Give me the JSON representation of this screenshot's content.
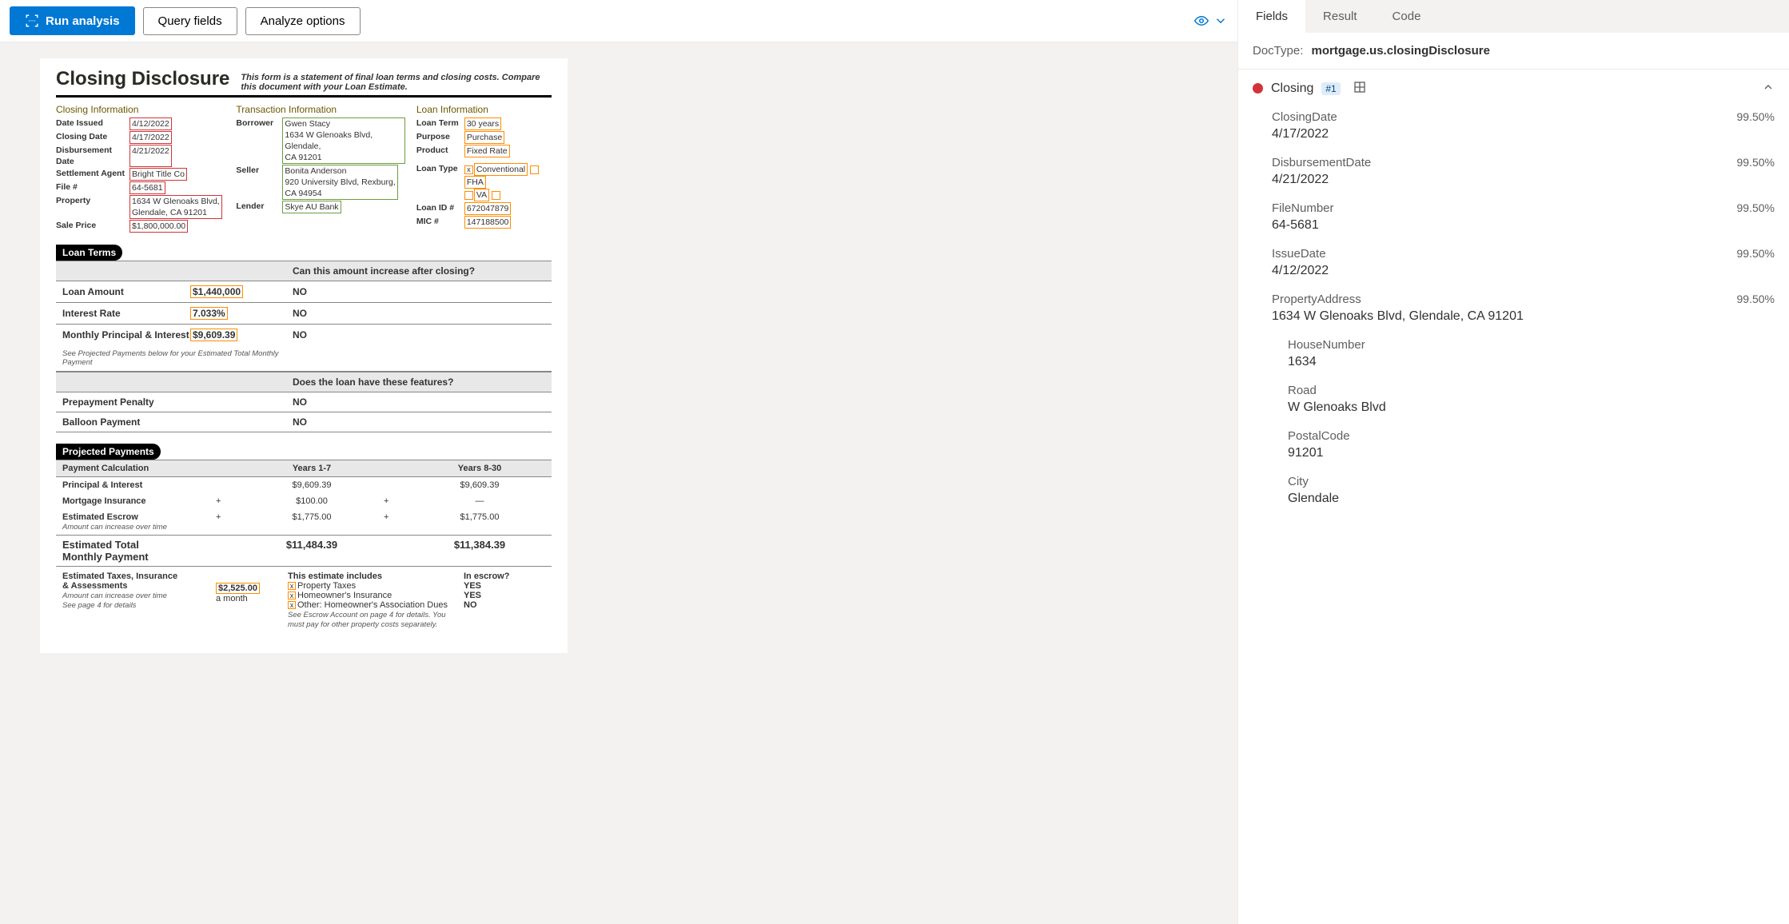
{
  "toolbar": {
    "run": "Run analysis",
    "query": "Query fields",
    "analyze": "Analyze options"
  },
  "doc": {
    "title": "Closing Disclosure",
    "subtitle": "This form is a statement of final loan terms and closing costs. Compare this document with your Loan Estimate.",
    "closing_info": {
      "title": "Closing  Information",
      "date_issued_lbl": "Date Issued",
      "date_issued": "4/12/2022",
      "closing_date_lbl": "Closing Date",
      "closing_date": "4/17/2022",
      "disb_date_lbl": "Disbursement Date",
      "disb_date": "4/21/2022",
      "settle_lbl": "Settlement Agent",
      "settle": "Bright Title Co",
      "file_lbl": "File #",
      "file": "64-5681",
      "prop_lbl": "Property",
      "prop1": "1634 W Glenoaks Blvd,",
      "prop2": "Glendale, CA 91201",
      "price_lbl": "Sale Price",
      "price": "$1,800,000.00"
    },
    "trans_info": {
      "title": "Transaction  Information",
      "borrower_lbl": "Borrower",
      "borrower_name": "Gwen Stacy",
      "borrower_addr1": "1634 W Glenoaks Blvd, Glendale,",
      "borrower_addr2": "CA 91201",
      "seller_lbl": "Seller",
      "seller_name": "Bonita Anderson",
      "seller_addr1": "920 University Blvd, Rexburg,",
      "seller_addr2": "CA 94954",
      "lender_lbl": "Lender",
      "lender": "Skye AU Bank"
    },
    "loan_info": {
      "title": "Loan  Information",
      "term_lbl": "Loan Term",
      "term": "30 years",
      "purpose_lbl": "Purpose",
      "purpose": "Purchase",
      "product_lbl": "Product",
      "product": "Fixed Rate",
      "type_lbl": "Loan Type",
      "type_conv": "Conventional",
      "type_fha": "FHA",
      "type_va": "VA",
      "id_lbl": "Loan ID #",
      "id": "672047879",
      "mic_lbl": "MIC #",
      "mic": "147188500"
    },
    "loan_terms": {
      "title": "Loan Terms",
      "q1": "Can this amount increase after closing?",
      "amount_lbl": "Loan Amount",
      "amount": "$1,440,000",
      "amount_ans": "NO",
      "rate_lbl": "Interest Rate",
      "rate": "7.033%",
      "rate_ans": "NO",
      "pi_lbl": "Monthly Principal & Interest",
      "pi": "$9,609.39",
      "pi_ans": "NO",
      "pi_note": "See Projected Payments below for your Estimated Total Monthly Payment",
      "q2": "Does the loan have these features?",
      "prepay_lbl": "Prepayment Penalty",
      "prepay_ans": "NO",
      "balloon_lbl": "Balloon Payment",
      "balloon_ans": "NO"
    },
    "projected": {
      "title": "Projected Payments",
      "calc_lbl": "Payment Calculation",
      "y17": "Years 1-7",
      "y830": "Years 8-30",
      "pi_lbl": "Principal & Interest",
      "pi_y17": "$9,609.39",
      "pi_y830": "$9,609.39",
      "mi_lbl": "Mortgage Insurance",
      "mi_y17": "$100.00",
      "mi_y830": "—",
      "esc_lbl": "Estimated Escrow",
      "esc_note": "Amount can increase over time",
      "esc_y17": "$1,775.00",
      "esc_y830": "$1,775.00",
      "tot_lbl1": "Estimated Total",
      "tot_lbl2": "Monthly Payment",
      "tot_y17": "$11,484.39",
      "tot_y830": "$11,384.39",
      "eti_lbl1": "Estimated Taxes, Insurance",
      "eti_lbl2": "& Assessments",
      "eti_note1": "Amount can increase over time",
      "eti_note2": "See page 4 for details",
      "eti_amt": "$2,525.00",
      "eti_per": "a month",
      "inc_hdr": "This estimate includes",
      "escrow_hdr": "In escrow?",
      "r1": "Property Taxes",
      "r1e": "YES",
      "r2": "Homeowner's Insurance",
      "r2e": "YES",
      "r3": "Other: Homeowner's Association Dues",
      "r3e": "NO",
      "inc_note": "See Escrow Account on page 4 for details. You must pay for other property costs separately."
    }
  },
  "right": {
    "tabs": {
      "fields": "Fields",
      "result": "Result",
      "code": "Code"
    },
    "doctype_lbl": "DocType:",
    "doctype_val": "mortgage.us.closingDisclosure",
    "acc": {
      "title": "Closing",
      "badge": "#1"
    },
    "fields": [
      {
        "name": "ClosingDate",
        "conf": "99.50%",
        "val": "4/17/2022",
        "indent": false
      },
      {
        "name": "DisbursementDate",
        "conf": "99.50%",
        "val": "4/21/2022",
        "indent": false
      },
      {
        "name": "FileNumber",
        "conf": "99.50%",
        "val": "64-5681",
        "indent": false
      },
      {
        "name": "IssueDate",
        "conf": "99.50%",
        "val": "4/12/2022",
        "indent": false
      },
      {
        "name": "PropertyAddress",
        "conf": "99.50%",
        "val": "1634 W Glenoaks Blvd, Glendale, CA 91201",
        "indent": false
      },
      {
        "name": "HouseNumber",
        "conf": "",
        "val": "1634",
        "indent": true
      },
      {
        "name": "Road",
        "conf": "",
        "val": "W Glenoaks Blvd",
        "indent": true
      },
      {
        "name": "PostalCode",
        "conf": "",
        "val": "91201",
        "indent": true
      },
      {
        "name": "City",
        "conf": "",
        "val": "Glendale",
        "indent": true
      }
    ]
  }
}
